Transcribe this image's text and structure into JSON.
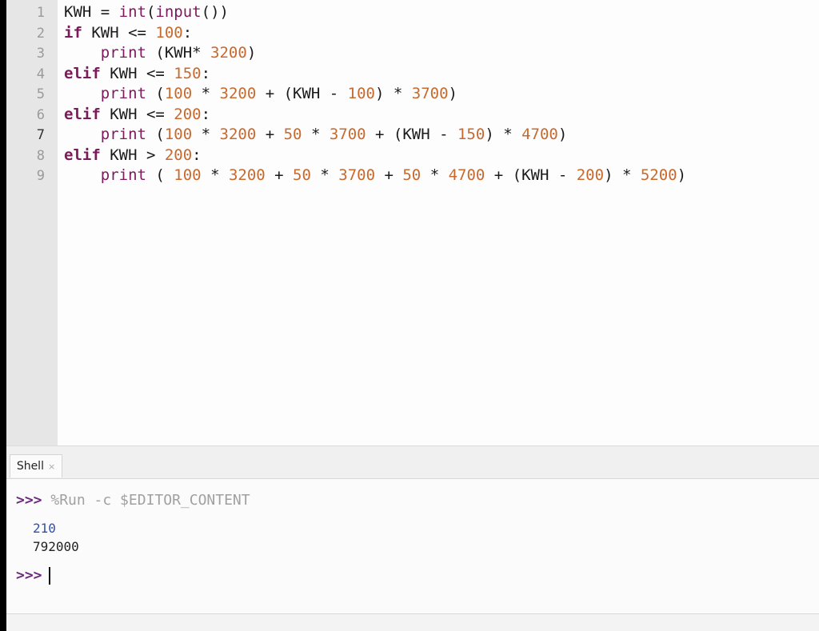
{
  "editor": {
    "line_numbers": [
      "1",
      "2",
      "3",
      "4",
      "5",
      "6",
      "7",
      "8",
      "9"
    ],
    "lines": [
      [
        {
          "t": "KWH = "
        },
        {
          "t": "int",
          "c": "fn"
        },
        {
          "t": "("
        },
        {
          "t": "input",
          "c": "fn"
        },
        {
          "t": "())"
        }
      ],
      [
        {
          "t": "if",
          "c": "kw"
        },
        {
          "t": " KWH <= "
        },
        {
          "t": "100",
          "c": "num"
        },
        {
          "t": ":"
        }
      ],
      [
        {
          "t": "    "
        },
        {
          "t": "print",
          "c": "fn"
        },
        {
          "t": " (KWH* "
        },
        {
          "t": "3200",
          "c": "num"
        },
        {
          "t": ")"
        }
      ],
      [
        {
          "t": "elif",
          "c": "kw"
        },
        {
          "t": " KWH <= "
        },
        {
          "t": "150",
          "c": "num"
        },
        {
          "t": ":"
        }
      ],
      [
        {
          "t": "    "
        },
        {
          "t": "print",
          "c": "fn"
        },
        {
          "t": " ("
        },
        {
          "t": "100",
          "c": "num"
        },
        {
          "t": " * "
        },
        {
          "t": "3200",
          "c": "num"
        },
        {
          "t": " + (KWH - "
        },
        {
          "t": "100",
          "c": "num"
        },
        {
          "t": ") * "
        },
        {
          "t": "3700",
          "c": "num"
        },
        {
          "t": ")"
        }
      ],
      [
        {
          "t": "elif",
          "c": "kw"
        },
        {
          "t": " KWH <= "
        },
        {
          "t": "200",
          "c": "num"
        },
        {
          "t": ":"
        }
      ],
      [
        {
          "t": "    "
        },
        {
          "t": "print",
          "c": "fn"
        },
        {
          "t": " ("
        },
        {
          "t": "100",
          "c": "num"
        },
        {
          "t": " * "
        },
        {
          "t": "3200",
          "c": "num"
        },
        {
          "t": " + "
        },
        {
          "t": "50",
          "c": "num"
        },
        {
          "t": " * "
        },
        {
          "t": "3700",
          "c": "num"
        },
        {
          "t": " + (KWH - "
        },
        {
          "t": "150",
          "c": "num"
        },
        {
          "t": ") * "
        },
        {
          "t": "4700",
          "c": "num"
        },
        {
          "t": ")"
        }
      ],
      [
        {
          "t": "elif",
          "c": "kw"
        },
        {
          "t": " KWH > "
        },
        {
          "t": "200",
          "c": "num"
        },
        {
          "t": ":"
        }
      ],
      [
        {
          "t": "    "
        },
        {
          "t": "print",
          "c": "fn"
        },
        {
          "t": " ( "
        },
        {
          "t": "100",
          "c": "num"
        },
        {
          "t": " * "
        },
        {
          "t": "3200",
          "c": "num"
        },
        {
          "t": " + "
        },
        {
          "t": "50",
          "c": "num"
        },
        {
          "t": " * "
        },
        {
          "t": "3700",
          "c": "num"
        },
        {
          "t": " + "
        },
        {
          "t": "50",
          "c": "num"
        },
        {
          "t": " * "
        },
        {
          "t": "4700",
          "c": "num"
        },
        {
          "t": " + (KWH - "
        },
        {
          "t": "200",
          "c": "num"
        },
        {
          "t": ") * "
        },
        {
          "t": "5200",
          "c": "num"
        },
        {
          "t": ")"
        }
      ]
    ],
    "active_line": "7"
  },
  "shell": {
    "tab_label": "Shell",
    "tab_close": "×",
    "prompt": ">>>",
    "run_command": "%Run -c $EDITOR_CONTENT",
    "outputs": [
      "210",
      "792000"
    ]
  },
  "colors": {
    "keyword": "#7b1a5a",
    "number": "#c8692d",
    "input_echo": "#3050b0"
  }
}
